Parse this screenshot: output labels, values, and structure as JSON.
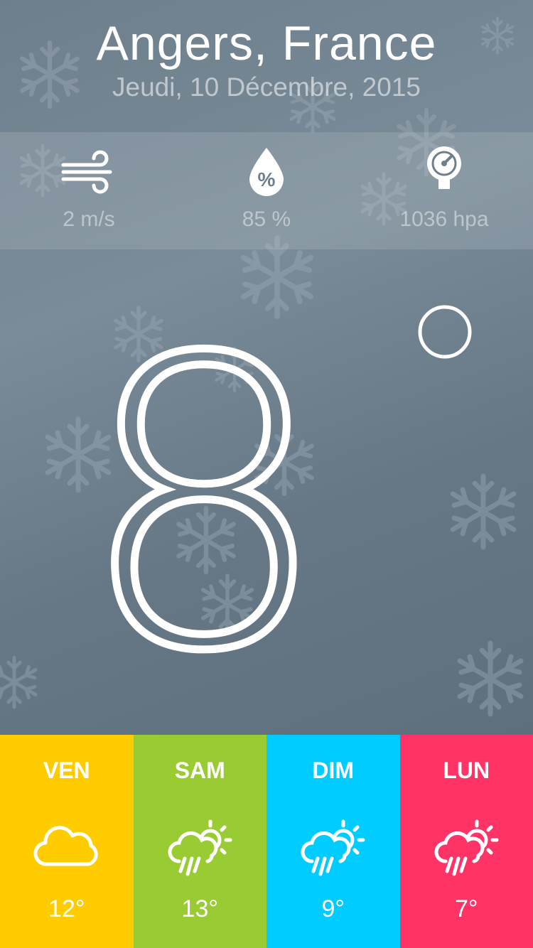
{
  "location": {
    "city": "Angers, France",
    "date": "Jeudi, 10 Décembre, 2015"
  },
  "stats": [
    {
      "icon": "wind-icon",
      "value": "2 m/s"
    },
    {
      "icon": "humidity-drop-icon",
      "value": "85 %"
    },
    {
      "icon": "pressure-gauge-icon",
      "value": "1036 hpa"
    }
  ],
  "current": {
    "temperature": "8",
    "unit_icon": "degree-ring-icon"
  },
  "forecast": [
    {
      "day": "VEN",
      "icon": "cloud-icon",
      "temp": "12°",
      "color": "#ffcc00"
    },
    {
      "day": "SAM",
      "icon": "sun-cloud-rain-icon",
      "temp": "13°",
      "color": "#99cc33"
    },
    {
      "day": "DIM",
      "icon": "sun-cloud-rain-icon",
      "temp": "9°",
      "color": "#00ccff"
    },
    {
      "day": "LUN",
      "icon": "sun-cloud-rain-icon",
      "temp": "7°",
      "color": "#ff3366"
    }
  ],
  "colors": {
    "background": "#6e7f8c",
    "stats_band": "rgba(255,255,255,0.12)"
  }
}
